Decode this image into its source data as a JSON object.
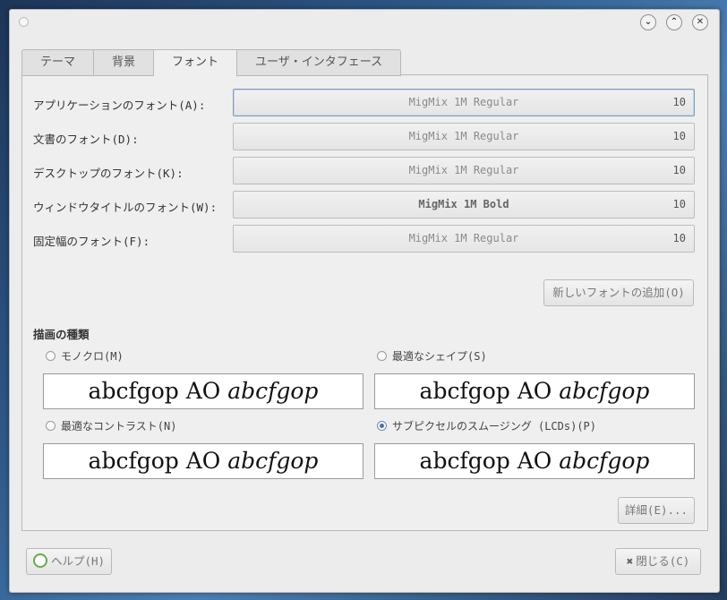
{
  "tabs": [
    {
      "label": "テーマ"
    },
    {
      "label": "背景"
    },
    {
      "label": "フォント"
    },
    {
      "label": "ユーザ・インタフェース"
    }
  ],
  "fonts": [
    {
      "label": "アプリケーションのフォント(A):",
      "name": "MigMix 1M Regular",
      "size": "10"
    },
    {
      "label": "文書のフォント(D):",
      "name": "MigMix 1M Regular",
      "size": "10"
    },
    {
      "label": "デスクトップのフォント(K):",
      "name": "MigMix 1M Regular",
      "size": "10"
    },
    {
      "label": "ウィンドウタイトルのフォント(W):",
      "name": "MigMix 1M Bold",
      "size": "10"
    },
    {
      "label": "固定幅のフォント(F):",
      "name": "MigMix 1M Regular",
      "size": "10"
    }
  ],
  "add_font_button": "新しいフォントの追加(O)",
  "rendering": {
    "title": "描画の種類",
    "options": [
      {
        "label": "モノクロ(M)",
        "selected": false,
        "sample_normal": "abcfgop AO",
        "sample_italic": "abcfgop"
      },
      {
        "label": "最適なシェイプ(S)",
        "selected": false,
        "sample_normal": "abcfgop AO",
        "sample_italic": "abcfgop"
      },
      {
        "label": "最適なコントラスト(N)",
        "selected": false,
        "sample_normal": "abcfgop AO",
        "sample_italic": "abcfgop"
      },
      {
        "label": "サブピクセルのスムージング (LCDs)(P)",
        "selected": true,
        "sample_normal": "abcfgop AO",
        "sample_italic": "abcfgop"
      }
    ]
  },
  "details_button": "詳細(E)...",
  "help_button": "ヘルプ(H)",
  "close_button": "閉じる(C)",
  "window_controls": {
    "minimize": "⌄",
    "maximize": "⌃",
    "close": "✕"
  }
}
